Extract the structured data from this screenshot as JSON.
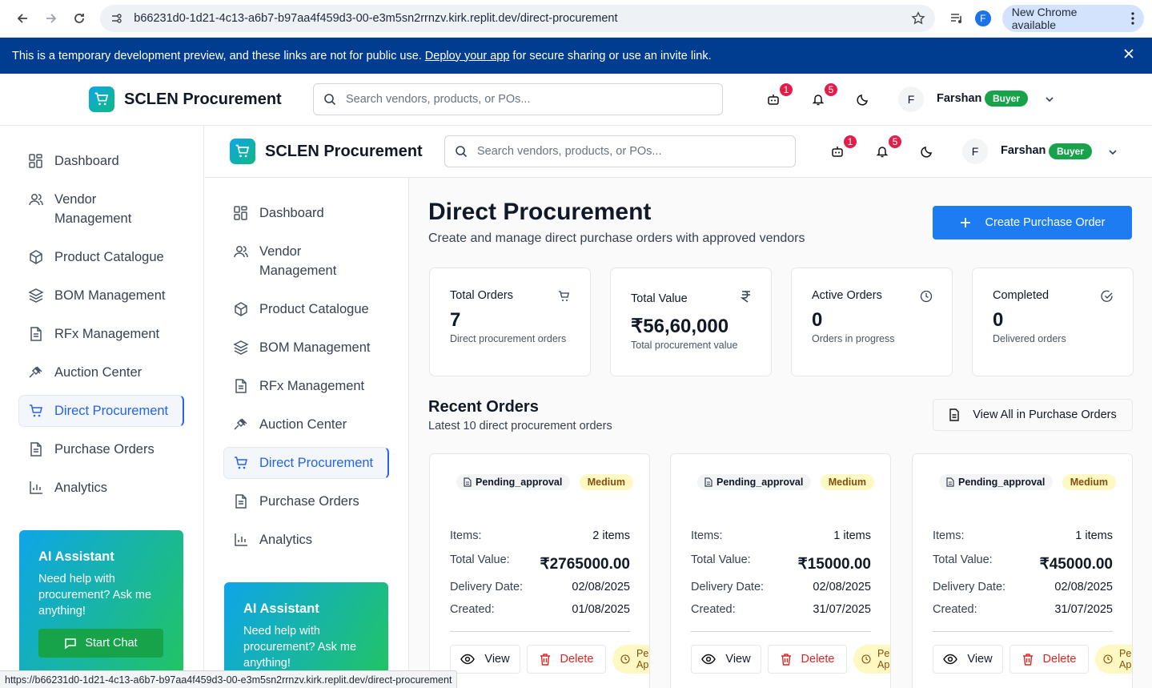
{
  "browser": {
    "url": "b66231d0-1d21-4c13-a6b7-b97aa4f459d3-00-e3m5sn2rrnzv.kirk.replit.dev/direct-procurement",
    "profile_initial": "F",
    "new_chrome": "New Chrome available"
  },
  "banner": {
    "text_before": "This is a temporary development preview, and these links are not for public use.",
    "link": "Deploy your app",
    "text_after": "for secure sharing or use an invite link."
  },
  "header": {
    "brand": "SCLEN Procurement",
    "search_placeholder": "Search vendors, products, or POs...",
    "cart_badge": "1",
    "notif_badge": "5",
    "user_initial": "F",
    "user_name": "Farshan",
    "role": "Buyer"
  },
  "sidebar": {
    "items": [
      {
        "label": "Dashboard"
      },
      {
        "label": "Vendor Management"
      },
      {
        "label": "Product Catalogue"
      },
      {
        "label": "BOM Management"
      },
      {
        "label": "RFx Management"
      },
      {
        "label": "Auction Center"
      },
      {
        "label": "Direct Procurement"
      },
      {
        "label": "Purchase Orders"
      },
      {
        "label": "Analytics"
      }
    ],
    "ai": {
      "title": "AI Assistant",
      "text": "Need help with procurement? Ask me anything!",
      "button": "Start Chat"
    }
  },
  "main": {
    "title": "Direct Procurement",
    "subtitle": "Create and manage direct purchase orders with approved vendors",
    "create_button": "Create Purchase Order",
    "stats": [
      {
        "label": "Total Orders",
        "value": "7",
        "desc": "Direct procurement orders",
        "icon": "cart-icon"
      },
      {
        "label": "Total Value",
        "value": "₹56,60,000",
        "desc": "Total procurement value",
        "icon": "rupee-icon"
      },
      {
        "label": "Active Orders",
        "value": "0",
        "desc": "Orders in progress",
        "icon": "clock-icon"
      },
      {
        "label": "Completed",
        "value": "0",
        "desc": "Delivered orders",
        "icon": "check-circle-icon"
      }
    ],
    "recent_title": "Recent Orders",
    "recent_sub": "Latest 10 direct procurement orders",
    "view_all": "View All in Purchase Orders",
    "labels": {
      "items": "Items:",
      "total_value": "Total Value:",
      "delivery": "Delivery Date:",
      "created": "Created:",
      "view": "View",
      "delete": "Delete",
      "pending_short": "Pending Approval"
    },
    "orders": [
      {
        "status": "Pending_approval",
        "priority": "Medium",
        "items": "2 items",
        "total": "₹2765000.00",
        "delivery": "02/08/2025",
        "created": "01/08/2025"
      },
      {
        "status": "Pending_approval",
        "priority": "Medium",
        "items": "1 items",
        "total": "₹15000.00",
        "delivery": "02/08/2025",
        "created": "31/07/2025"
      },
      {
        "status": "Pending_approval",
        "priority": "Medium",
        "items": "1 items",
        "total": "₹45000.00",
        "delivery": "02/08/2025",
        "created": "31/07/2025"
      }
    ]
  },
  "statusbar": "https://b66231d0-1d21-4c13-a6b7-b97aa4f459d3-00-e3m5sn2rrnzv.kirk.replit.dev/direct-procurement",
  "colors": {
    "primary": "#1d7cf2",
    "banner": "#003c8f",
    "role": "#16a34a",
    "danger": "#dc2626"
  }
}
